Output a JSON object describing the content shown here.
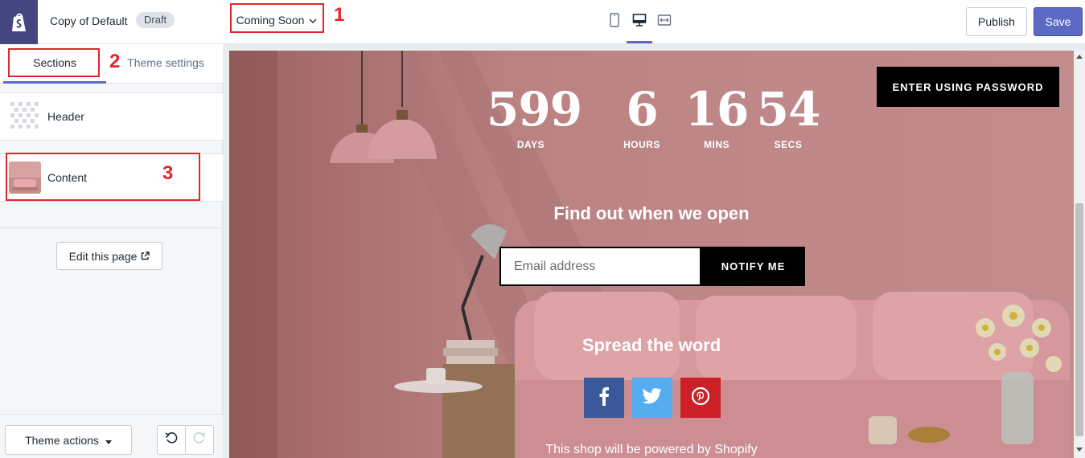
{
  "sidebar": {
    "theme_name": "Copy of Default",
    "status_badge": "Draft",
    "tabs": [
      {
        "label": "Sections"
      },
      {
        "label": "Theme settings"
      }
    ],
    "sections": [
      {
        "label": "Header"
      },
      {
        "label": "Content"
      }
    ],
    "edit_page_label": "Edit this page",
    "theme_actions_label": "Theme actions"
  },
  "topbar": {
    "template_select": "Coming Soon",
    "publish_label": "Publish",
    "save_label": "Save",
    "device_icons": [
      "mobile-icon",
      "desktop-icon",
      "fullscreen-icon"
    ],
    "active_device": "desktop"
  },
  "annotations": [
    "1",
    "2",
    "3"
  ],
  "preview": {
    "countdown": [
      {
        "value": "599",
        "label": "DAYS"
      },
      {
        "value": "6",
        "label": "HOURS"
      },
      {
        "value": "16",
        "label": "MINS"
      },
      {
        "value": "54",
        "label": "SECS"
      }
    ],
    "enter_password_label": "ENTER USING PASSWORD",
    "find_out_heading": "Find out when we open",
    "email_placeholder": "Email address",
    "notify_label": "NOTIFY ME",
    "spread_heading": "Spread the word",
    "social": [
      "facebook-icon",
      "twitter-icon",
      "pinterest-icon"
    ],
    "powered_by": "This shop will be powered by Shopify"
  },
  "colors": {
    "accent": "#5c6ac4",
    "logo_bg": "#43467f",
    "annotation": "#e0262a",
    "facebook": "#3b5998",
    "twitter": "#55acee",
    "pinterest": "#cb2027",
    "preview_bg": "#c88a8a"
  }
}
